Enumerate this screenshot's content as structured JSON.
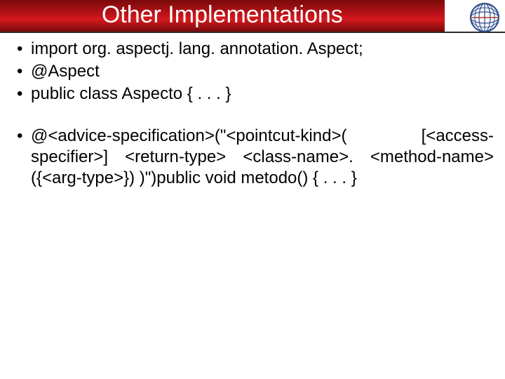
{
  "title": "Other Implementations",
  "bullets": {
    "b1": "import org. aspectj. lang. annotation. Aspect;",
    "b2": "@Aspect",
    "b3": "public class Aspecto { . . . }",
    "b4": "@<advice-specification>(\"<pointcut-kind>( [<access-specifier>] <return-type> <class-name>. <method-name>({<arg-type>}) )\")public void metodo() { . . . }"
  }
}
